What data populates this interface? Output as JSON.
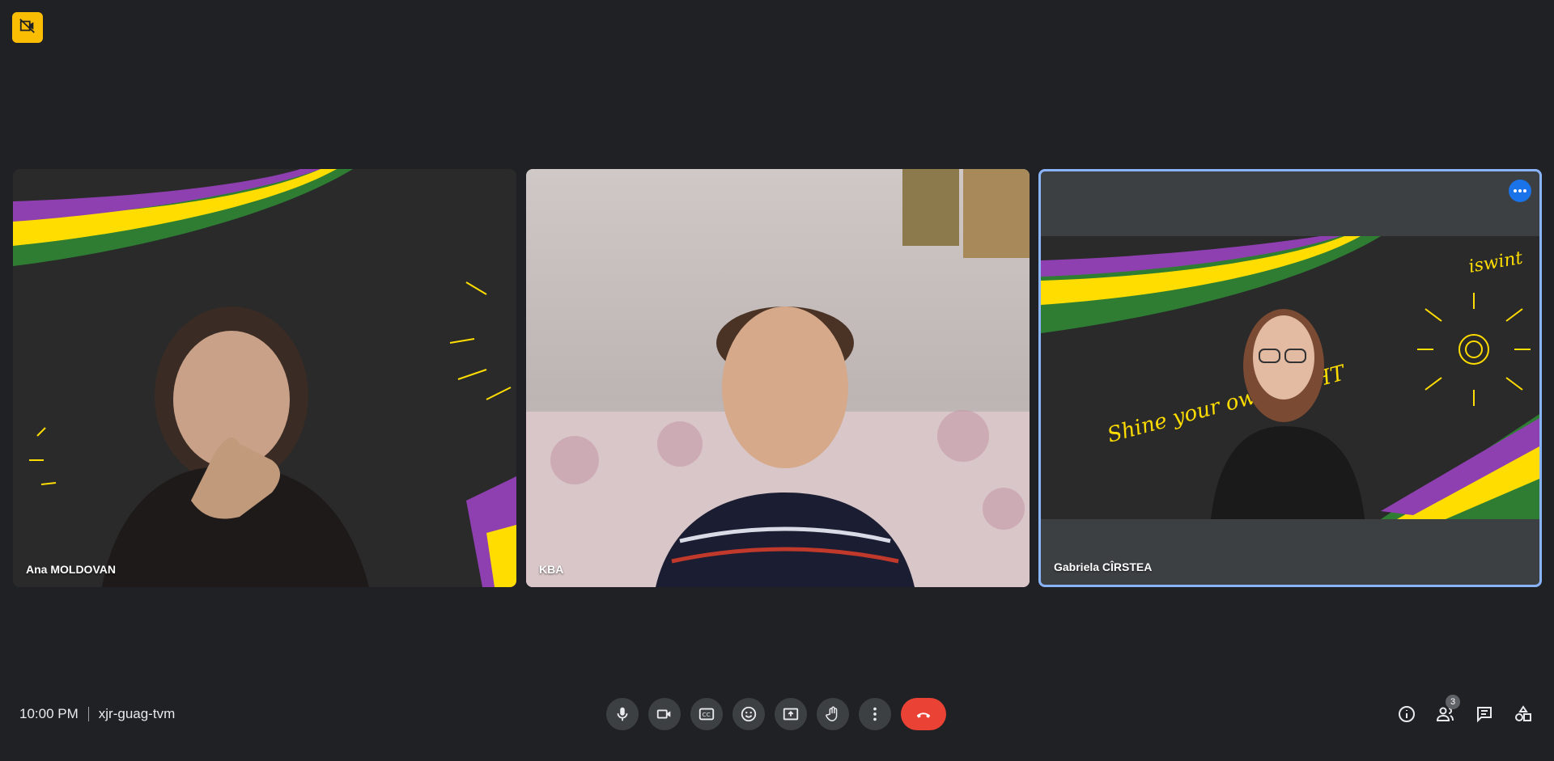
{
  "top_badge": {
    "icon": "camera-off-icon",
    "color": "#fbbc04"
  },
  "participants": [
    {
      "name": "Ana MOLDOVAN",
      "background": "chalkboard with ribbons"
    },
    {
      "name": "KBA",
      "background": "room"
    },
    {
      "name": "Gabriela CÎRSTEA",
      "background": "chalkboard with ribbons",
      "active": true
    }
  ],
  "tile_overlay": {
    "shine_text": "Shine your own LIGHT",
    "logo_text": "iswint"
  },
  "meeting": {
    "time": "10:00 PM",
    "code": "xjr-guag-tvm"
  },
  "controls": [
    {
      "name": "microphone",
      "icon": "mic-icon"
    },
    {
      "name": "camera",
      "icon": "camera-icon"
    },
    {
      "name": "captions",
      "icon": "captions-icon"
    },
    {
      "name": "reactions",
      "icon": "emoji-icon"
    },
    {
      "name": "present",
      "icon": "present-icon"
    },
    {
      "name": "raise-hand",
      "icon": "hand-icon"
    },
    {
      "name": "more-options",
      "icon": "more-vert-icon"
    },
    {
      "name": "leave-call",
      "icon": "end-call-icon",
      "color": "#ea4335"
    }
  ],
  "right_panel": {
    "info_icon": "info-icon",
    "people_count": "3",
    "chat_icon": "chat-icon",
    "activities_icon": "activities-icon"
  },
  "colors": {
    "background": "#202124",
    "active_border": "#8ab4f8",
    "accent": "#1a73e8"
  }
}
